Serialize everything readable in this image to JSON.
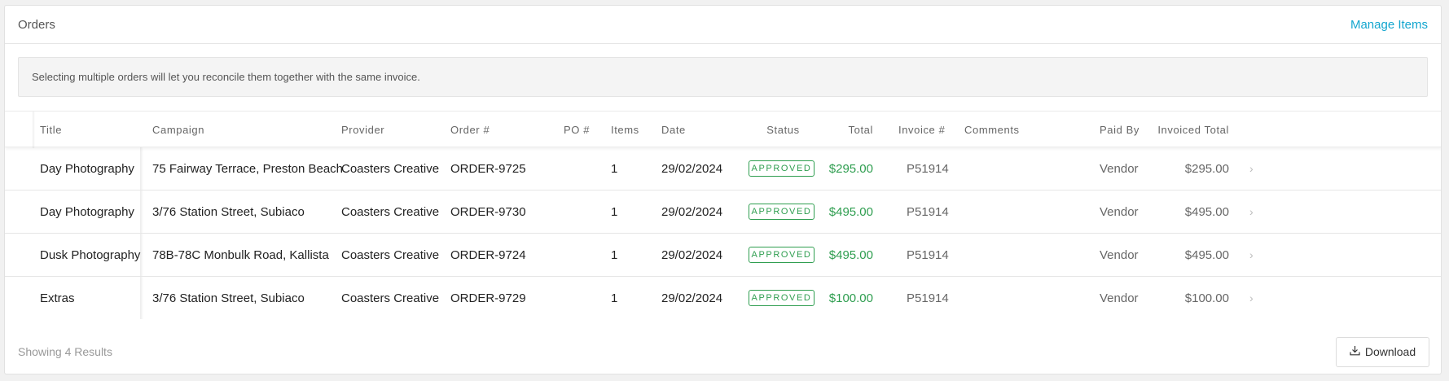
{
  "header": {
    "title": "Orders",
    "manage_label": "Manage Items"
  },
  "notice": "Selecting multiple orders will let you reconcile them together with the same invoice.",
  "columns": {
    "title": "Title",
    "campaign": "Campaign",
    "provider": "Provider",
    "order": "Order #",
    "po": "PO #",
    "items": "Items",
    "date": "Date",
    "status": "Status",
    "total": "Total",
    "invoice": "Invoice #",
    "comments": "Comments",
    "paid_by": "Paid By",
    "invoiced_total": "Invoiced Total"
  },
  "rows": [
    {
      "title": "Day Photography",
      "campaign": "75 Fairway Terrace, Preston Beach",
      "provider": "Coasters Creative",
      "order": "ORDER-9725",
      "po": "",
      "items": "1",
      "date": "29/02/2024",
      "status": "APPROVED",
      "total": "$295.00",
      "invoice": "P51914",
      "comments": "",
      "paid_by": "Vendor",
      "invoiced_total": "$295.00"
    },
    {
      "title": "Day Photography",
      "campaign": "3/76 Station Street, Subiaco",
      "provider": "Coasters Creative",
      "order": "ORDER-9730",
      "po": "",
      "items": "1",
      "date": "29/02/2024",
      "status": "APPROVED",
      "total": "$495.00",
      "invoice": "P51914",
      "comments": "",
      "paid_by": "Vendor",
      "invoiced_total": "$495.00"
    },
    {
      "title": "Dusk Photography",
      "campaign": "78B-78C Monbulk Road, Kallista",
      "provider": "Coasters Creative",
      "order": "ORDER-9724",
      "po": "",
      "items": "1",
      "date": "29/02/2024",
      "status": "APPROVED",
      "total": "$495.00",
      "invoice": "P51914",
      "comments": "",
      "paid_by": "Vendor",
      "invoiced_total": "$495.00"
    },
    {
      "title": "Extras",
      "campaign": "3/76 Station Street, Subiaco",
      "provider": "Coasters Creative",
      "order": "ORDER-9729",
      "po": "",
      "items": "1",
      "date": "29/02/2024",
      "status": "APPROVED",
      "total": "$100.00",
      "invoice": "P51914",
      "comments": "",
      "paid_by": "Vendor",
      "invoiced_total": "$100.00"
    }
  ],
  "footer": {
    "showing": "Showing 4 Results",
    "download_label": "Download"
  },
  "icons": {
    "row_chevron": "chevron-right-icon",
    "download": "download-icon"
  },
  "colors": {
    "accent": "#13a6cf",
    "approved": "#2f9e50"
  }
}
